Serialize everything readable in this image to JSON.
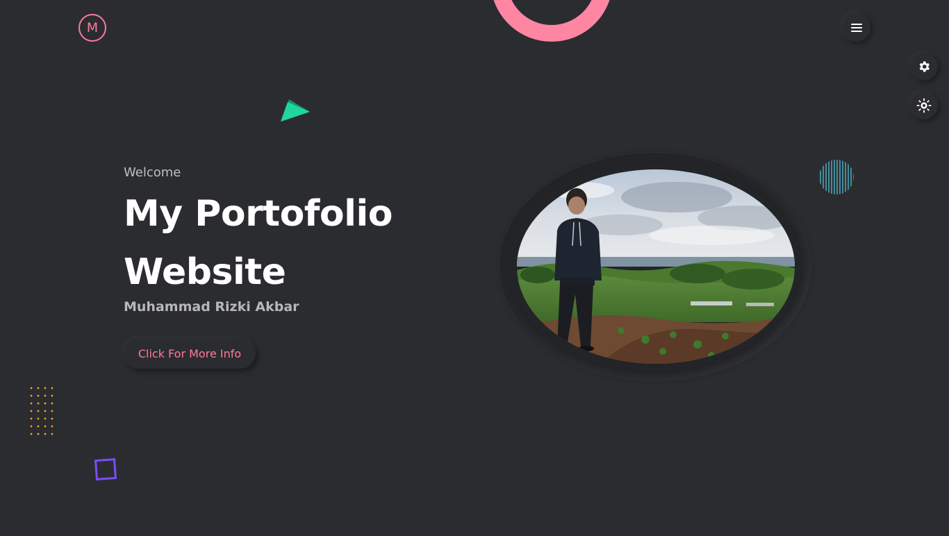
{
  "logo": {
    "letter": "M"
  },
  "hero": {
    "welcome": "Welcome",
    "title_line1": "My Portofolio",
    "title_line2": "Website",
    "author": "Muhammad Rizki Akbar",
    "cta_label": "Click For More Info"
  },
  "icons": {
    "menu": "hamburger-menu-icon",
    "settings": "gear-icon",
    "theme": "sun-icon"
  },
  "colors": {
    "background": "#2b2c30",
    "accent_pink": "#ff7a9a",
    "accent_green": "#1fd6a0",
    "accent_purple": "#7b4dff",
    "accent_orange": "#f5a623",
    "accent_teal": "#4fc3d9"
  }
}
